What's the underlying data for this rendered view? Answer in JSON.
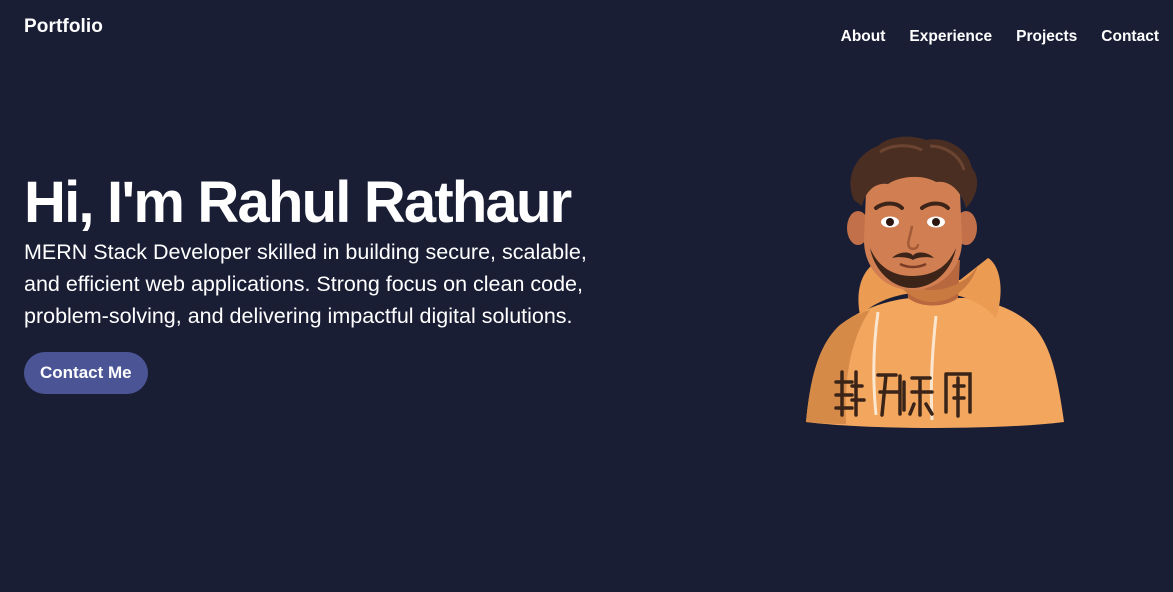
{
  "header": {
    "brand": "Portfolio",
    "nav": [
      {
        "label": "About"
      },
      {
        "label": "Experience"
      },
      {
        "label": "Projects"
      },
      {
        "label": "Contact"
      }
    ]
  },
  "hero": {
    "title": "Hi, I'm Rahul Rathaur",
    "description": "MERN Stack Developer skilled in building secure, scalable, and efficient web applications. Strong focus on clean code, problem-solving, and delivering impactful digital solutions.",
    "cta_label": "Contact Me",
    "avatar_icon": "cartoon-avatar-illustration"
  },
  "colors": {
    "background": "#1a1e35",
    "text": "#ffffff",
    "button": "#4b5596",
    "hoodie": "#f2a65e",
    "skin": "#d17f52",
    "hair": "#4a2e22"
  }
}
